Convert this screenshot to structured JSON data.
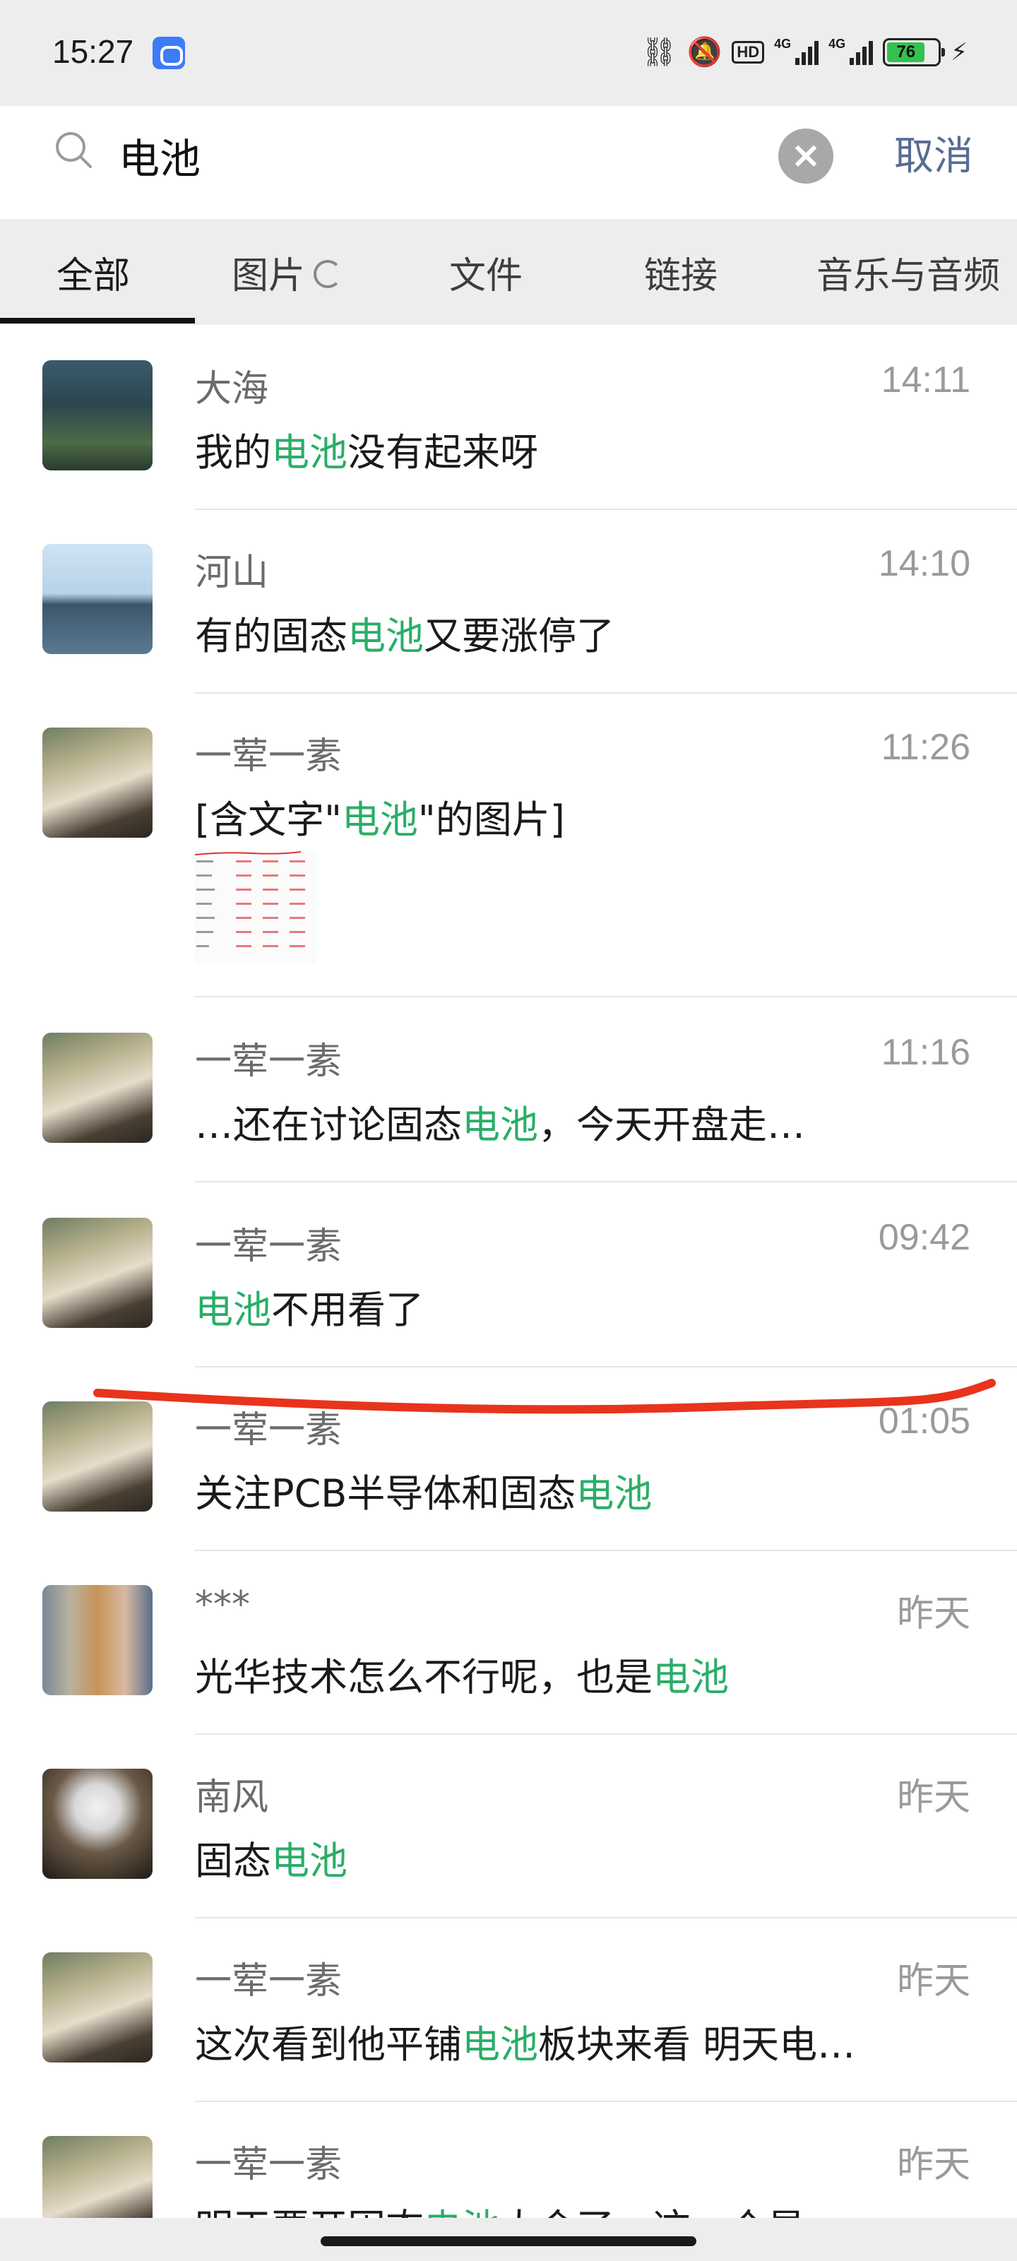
{
  "status_bar": {
    "time": "15:27",
    "signal_1": "4G",
    "signal_2": "4G",
    "hd_label": "HD",
    "battery": "76"
  },
  "search": {
    "query": "电池",
    "cancel_label": "取消"
  },
  "tabs": [
    {
      "label": "全部"
    },
    {
      "label": "图片"
    },
    {
      "label": "文件"
    },
    {
      "label": "链接"
    },
    {
      "label": "音乐与音频"
    }
  ],
  "results": [
    {
      "name": "大海",
      "time": "14:11",
      "pre": "我的",
      "hl": "电池",
      "post": "没有起来呀",
      "avatar": "sea-avatar"
    },
    {
      "name": "河山",
      "time": "14:10",
      "pre": "有的固态",
      "hl": "电池",
      "post": "又要涨停了",
      "avatar": "lake-avatar"
    },
    {
      "name": "一荤一素",
      "time": "11:26",
      "pre": "[含文字\"",
      "hl": "电池",
      "post": "\"的图片]",
      "avatar": "person-avatar"
    },
    {
      "name": "一荤一素",
      "time": "11:16",
      "pre": "…还在讨论固态",
      "hl": "电池",
      "post": "，今天开盘走…",
      "avatar": "person-avatar"
    },
    {
      "name": "一荤一素",
      "time": "09:42",
      "pre": "",
      "hl": "电池",
      "post": "不用看了",
      "avatar": "person-avatar"
    },
    {
      "name": "一荤一素",
      "time": "01:05",
      "pre": "关注PCB半导体和固态",
      "hl": "电池",
      "post": "",
      "avatar": "person-avatar"
    },
    {
      "name": "***",
      "time": "昨天",
      "pre": "光华技术怎么不行呢，也是",
      "hl": "电池",
      "post": "",
      "avatar": "art-avatar"
    },
    {
      "name": "南风",
      "time": "昨天",
      "pre": "固态",
      "hl": "电池",
      "post": "",
      "avatar": "girl-avatar"
    },
    {
      "name": "一荤一素",
      "time": "昨天",
      "pre": "这次看到他平铺",
      "hl": "电池",
      "post": "板块来看 明天电…",
      "avatar": "person-avatar"
    },
    {
      "name": "一荤一素",
      "time": "昨天",
      "pre": "明天要开固态",
      "hl": "电池",
      "post": "大会了，这一个星",
      "avatar": "person-avatar"
    }
  ]
}
